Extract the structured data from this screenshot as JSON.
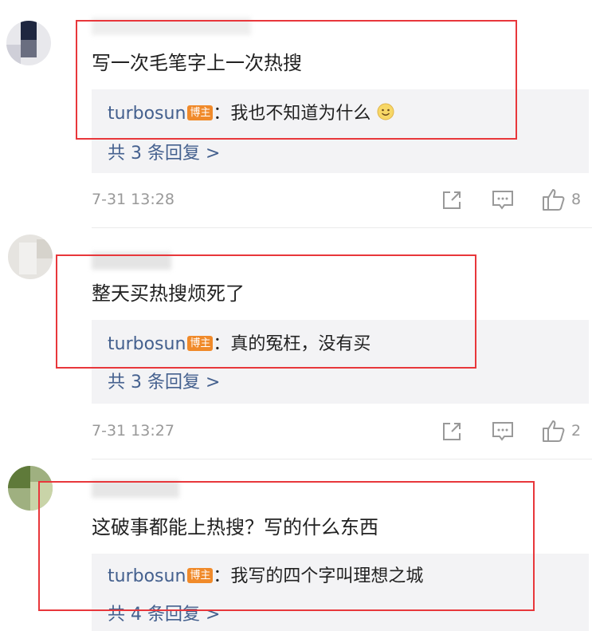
{
  "comments": [
    {
      "text": "写一次毛笔字上一次热搜",
      "reply": {
        "user": "turbosun",
        "badge": "博主",
        "separator": "：",
        "text": "我也不知道为什么",
        "emoji": "smile-emoji"
      },
      "more": "共 3 条回复 >",
      "time": "7-31 13:28",
      "likes": "8"
    },
    {
      "text": "整天买热搜烦死了",
      "reply": {
        "user": "turbosun",
        "badge": "博主",
        "separator": "：",
        "text": "真的冤枉，没有买"
      },
      "more": "共 3 条回复 >",
      "time": "7-31 13:27",
      "likes": "2"
    },
    {
      "text": "这破事都能上热搜？写的什么东西",
      "reply": {
        "user": "turbosun",
        "badge": "博主",
        "separator": "：",
        "text": "我写的四个字叫理想之城"
      },
      "more": "共 4 条回复 >"
    }
  ],
  "icons": [
    "share-icon",
    "comment-icon",
    "like-icon"
  ],
  "colors": {
    "link": "#44608e",
    "badge": "#f08a2a",
    "highlight_box": "#e8373b",
    "reply_bg": "#f3f3f5"
  }
}
